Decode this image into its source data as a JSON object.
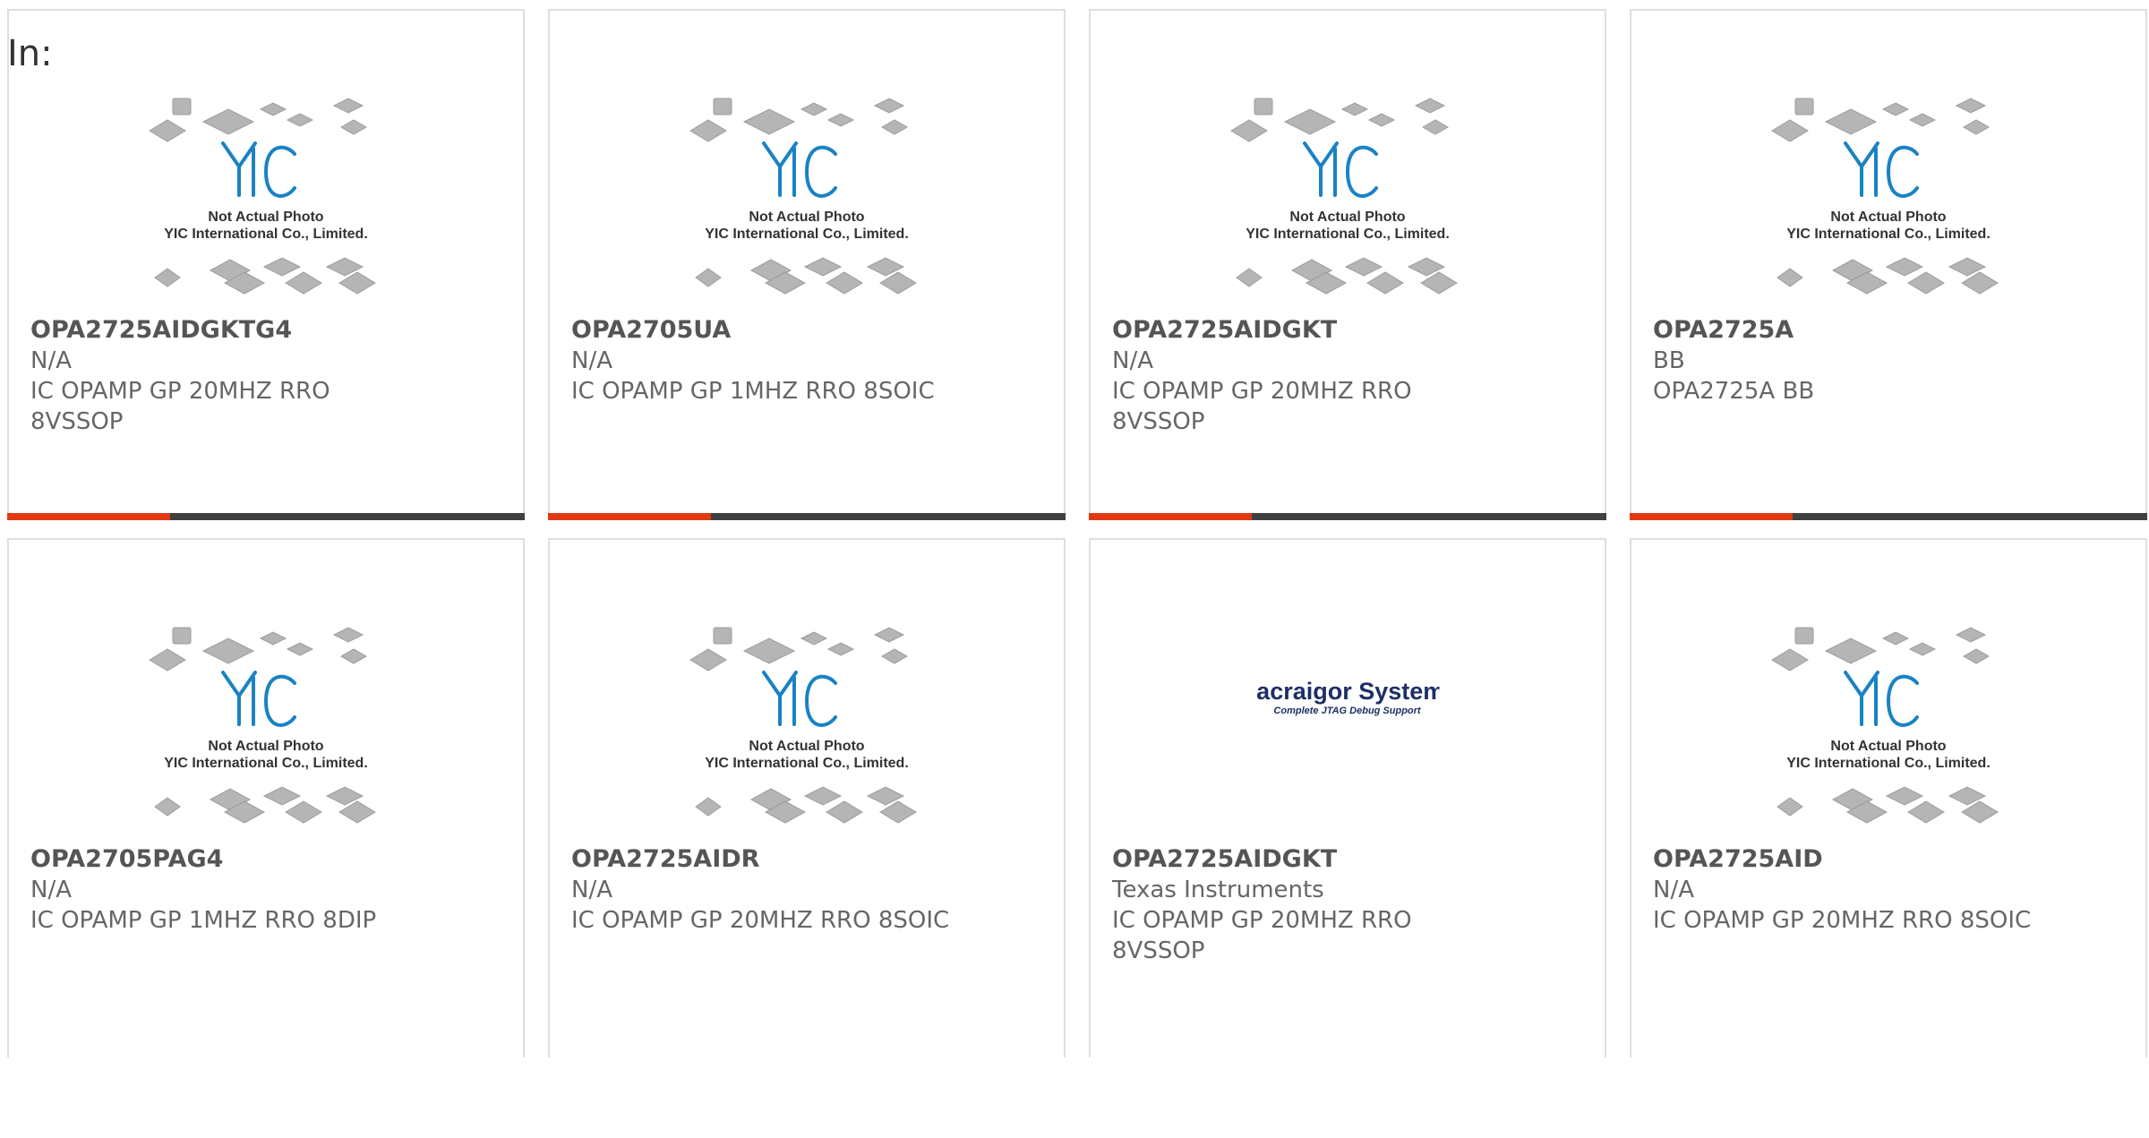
{
  "filter": {
    "label": "In:"
  },
  "products": [
    {
      "image": "yic",
      "image_caption": {
        "line1": "Not Actual Photo",
        "line2": "YIC International Co., Limited."
      },
      "part_number": "OPA2725AIDGKTG4",
      "manufacturer": "N/A",
      "description": "IC OPAMP GP 20MHZ RRO 8VSSOP"
    },
    {
      "image": "yic",
      "image_caption": {
        "line1": "Not Actual Photo",
        "line2": "YIC International Co., Limited."
      },
      "part_number": "OPA2705UA",
      "manufacturer": "N/A",
      "description": "IC OPAMP GP 1MHZ RRO 8SOIC"
    },
    {
      "image": "yic",
      "image_caption": {
        "line1": "Not Actual Photo",
        "line2": "YIC International Co., Limited."
      },
      "part_number": "OPA2725AIDGKT",
      "manufacturer": "N/A",
      "description": "IC OPAMP GP 20MHZ RRO 8VSSOP"
    },
    {
      "image": "yic",
      "image_caption": {
        "line1": "Not Actual Photo",
        "line2": "YIC International Co., Limited."
      },
      "part_number": "OPA2725A",
      "manufacturer": "BB",
      "description": "OPA2725A BB"
    },
    {
      "image": "yic",
      "image_caption": {
        "line1": "Not Actual Photo",
        "line2": "YIC International Co., Limited."
      },
      "part_number": "OPA2705PAG4",
      "manufacturer": "N/A",
      "description": "IC OPAMP GP 1MHZ RRO 8DIP"
    },
    {
      "image": "yic",
      "image_caption": {
        "line1": "Not Actual Photo",
        "line2": "YIC International Co., Limited."
      },
      "part_number": "OPA2725AIDR",
      "manufacturer": "N/A",
      "description": "IC OPAMP GP 20MHZ RRO 8SOIC"
    },
    {
      "image": "macraigor",
      "image_caption": {
        "line1": "Macraigor Systems",
        "line2": "Complete JTAG Debug Support"
      },
      "part_number": "OPA2725AIDGKT",
      "manufacturer": "Texas Instruments",
      "description": "IC OPAMP GP 20MHZ RRO 8VSSOP"
    },
    {
      "image": "yic",
      "image_caption": {
        "line1": "Not Actual Photo",
        "line2": "YIC International Co., Limited."
      },
      "part_number": "OPA2725AID",
      "manufacturer": "N/A",
      "description": "IC OPAMP GP 20MHZ RRO 8SOIC"
    }
  ],
  "colors": {
    "accent": "#e03a12",
    "bar": "#404040",
    "logo_blue": "#1a82c4",
    "chip_gray": "#a6a6a6"
  }
}
